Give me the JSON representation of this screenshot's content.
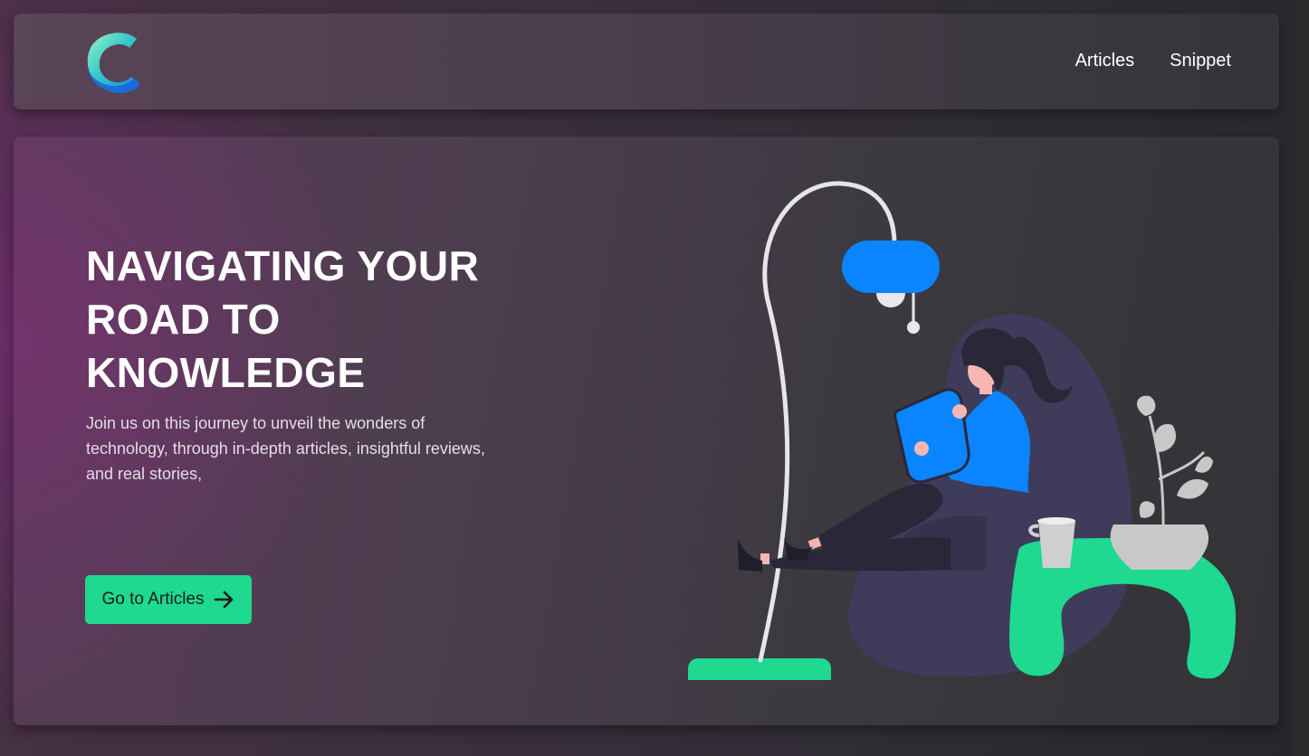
{
  "nav": {
    "logo_icon": "c-logo-icon",
    "links": [
      {
        "label": "Articles"
      },
      {
        "label": "Snippet"
      }
    ]
  },
  "hero": {
    "title": "NAVIGATING YOUR ROAD TO KNOWLEDGE",
    "subtitle": "Join us on this journey to unveil the wonders of technology, through in-depth articles, insightful reviews, and real stories,",
    "cta_label": "Go to Articles",
    "cta_icon": "arrow-right-icon",
    "illustration": "woman-reading-on-beanbag-illustration"
  },
  "colors": {
    "accent_green": "#1ed98f",
    "accent_blue": "#0a84ff",
    "text_white": "#ffffff"
  }
}
